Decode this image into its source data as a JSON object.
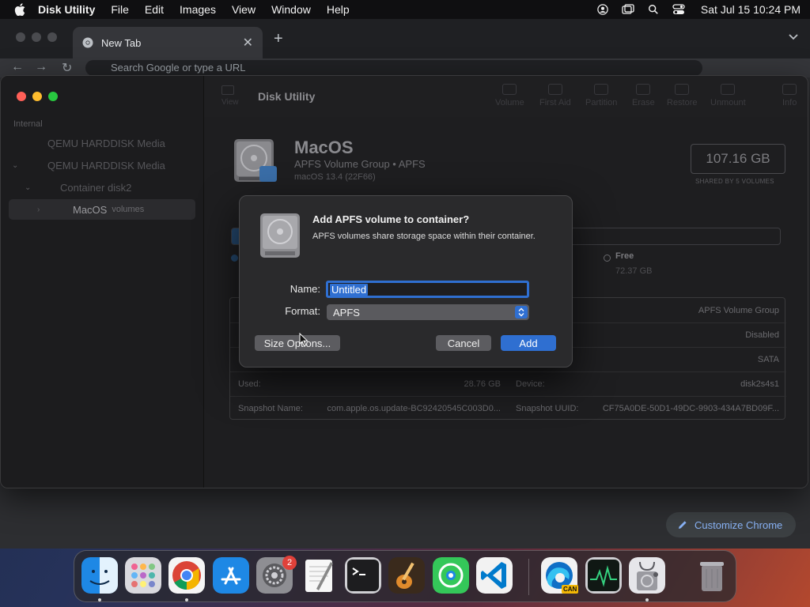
{
  "menubar": {
    "app_name": "Disk Utility",
    "items": [
      "File",
      "Edit",
      "Images",
      "View",
      "Window",
      "Help"
    ],
    "clock": "Sat Jul 15  10:24 PM"
  },
  "chrome": {
    "tab_title": "New Tab",
    "omnibox_placeholder": "Search Google or type a URL",
    "customize_label": "Customize Chrome"
  },
  "disk_utility": {
    "title": "Disk Utility",
    "toolbar": {
      "view": "View",
      "buttons": [
        "Volume",
        "First Aid",
        "Partition",
        "Erase",
        "Restore",
        "Unmount",
        "Info"
      ]
    },
    "sidebar": {
      "section": "Internal",
      "items": [
        {
          "label": "QEMU HARDDISK Media",
          "sub": ""
        },
        {
          "label": "QEMU HARDDISK Media",
          "sub": ""
        },
        {
          "label": "Container disk2",
          "sub": ""
        },
        {
          "label": "MacOS",
          "sub": "volumes"
        }
      ]
    },
    "volume": {
      "name": "MacOS",
      "subtitle": "APFS Volume Group • APFS",
      "version": "macOS 13.4 (22F66)",
      "capacity": "107.16 GB",
      "capacity_note": "SHARED BY 5 VOLUMES",
      "used_fraction": 0.27,
      "free_label": "Free",
      "free_value": "72.37 GB"
    },
    "info": {
      "rows": [
        {
          "left_label": "",
          "left_value": "",
          "right_label": "",
          "right_value": "APFS Volume Group"
        },
        {
          "left_label": "",
          "left_value": "",
          "right_label": "",
          "right_value": "Disabled"
        },
        {
          "left_label": "",
          "left_value": "",
          "right_label": "",
          "right_value": "SATA"
        },
        {
          "left_label": "Used:",
          "left_value": "28.76 GB",
          "right_label": "Device:",
          "right_value": "disk2s4s1"
        },
        {
          "left_label": "Snapshot Name:",
          "left_value": "com.apple.os.update-BC92420545C003D0...",
          "right_label": "Snapshot UUID:",
          "right_value": "CF75A0DE-50D1-49DC-9903-434A7BD09F..."
        }
      ]
    }
  },
  "dialog": {
    "title": "Add APFS volume to container?",
    "message": "APFS volumes share storage space within their container.",
    "name_label": "Name:",
    "name_value": "Untitled",
    "format_label": "Format:",
    "format_value": "APFS",
    "size_options": "Size Options...",
    "cancel": "Cancel",
    "add": "Add"
  },
  "dock": {
    "apps": [
      "Finder",
      "Launchpad",
      "Google Chrome",
      "App Store",
      "System Settings",
      "TextEdit",
      "Terminal",
      "GarageBand",
      "Find My",
      "Visual Studio Code",
      "Microsoft Edge Canary",
      "Activity Monitor",
      "Disk Utility",
      "Trash"
    ],
    "settings_badge": "2",
    "edge_badge": "CAN"
  },
  "colors": {
    "accent": "#2f6fd1",
    "used_storage": "#24486e",
    "badge_red": "#e0413a"
  }
}
